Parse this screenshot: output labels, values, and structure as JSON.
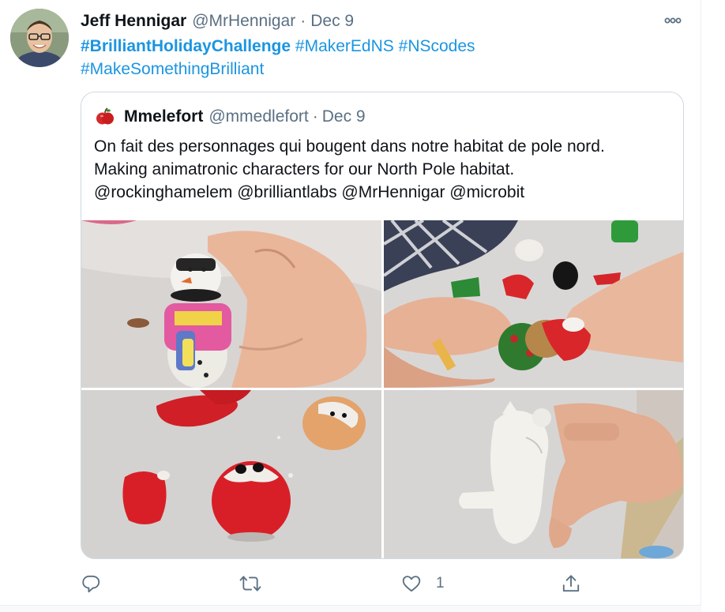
{
  "tweet": {
    "author_name": "Jeff Hennigar",
    "author_handle": "@MrHennigar",
    "separator": "·",
    "date": "Dec 9",
    "more_icon": "more-horizontal-icon",
    "hashtags": [
      "#BrilliantHolidayChallenge",
      "#MakerEdNS",
      "#NScodes",
      "#MakeSomethingBrilliant"
    ],
    "colors": {
      "link": "#1b95e0",
      "secondary": "#5b7083",
      "border": "#cfd9de"
    }
  },
  "quoted": {
    "author_name": "Mmelefort",
    "author_handle": "@mmedlefort",
    "separator": "·",
    "date": "Dec 9",
    "text_lines": [
      "On fait des personnages qui bougent dans notre habitat de pole nord.",
      "Making animatronic characters for our North Pole habitat.",
      "@rockinghamelem @brilliantlabs @MrHennigar @microbit"
    ],
    "photos": [
      "clay snowman held in hand",
      "hands molding clay pieces",
      "red clay santa figures",
      "white clay bear figure"
    ]
  },
  "actions": {
    "reply_icon": "reply-icon",
    "retweet_icon": "retweet-icon",
    "like_icon": "heart-icon",
    "like_count": "1",
    "share_icon": "share-icon"
  }
}
